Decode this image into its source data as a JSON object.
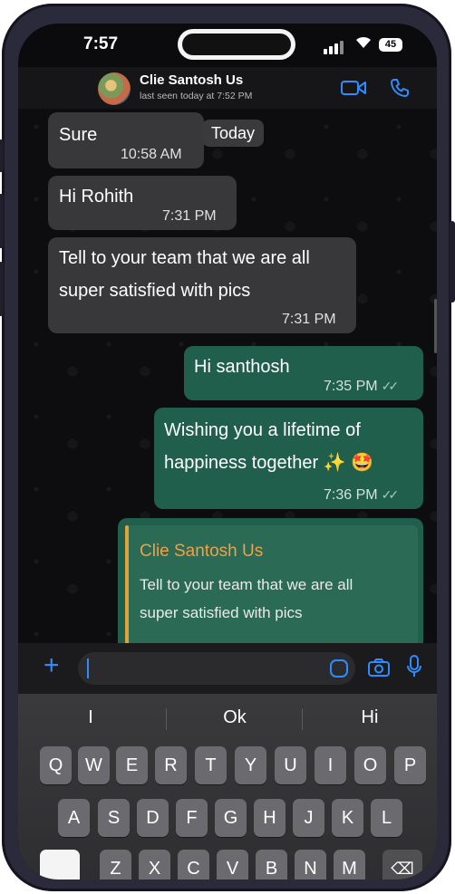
{
  "status_bar": {
    "time": "7:57",
    "battery": "45"
  },
  "header": {
    "contact_name": "Clie Santosh Us",
    "last_seen": "last seen today at 7:52 PM"
  },
  "chat": {
    "date_chip": "Today",
    "messages": [
      {
        "direction": "incoming",
        "lines": [
          "Sure"
        ],
        "time": "10:58 AM"
      },
      {
        "direction": "incoming",
        "lines": [
          "Hi Rohith"
        ],
        "time": "7:31 PM"
      },
      {
        "direction": "incoming",
        "lines": [
          "Tell to your team that we are all",
          "super satisfied with pics"
        ],
        "time": "7:31 PM"
      },
      {
        "direction": "outgoing",
        "lines": [
          "Hi santhosh"
        ],
        "time": "7:35 PM",
        "read": true
      },
      {
        "direction": "outgoing",
        "lines": [
          "Wishing you a lifetime of",
          "happiness together ✨ 🤩"
        ],
        "time": "7:36 PM",
        "read": true
      },
      {
        "direction": "outgoing",
        "reply": {
          "author": "Clie Santosh Us",
          "lines": [
            "Tell to your team that we are all",
            "super satisfied with pics"
          ]
        }
      }
    ]
  },
  "input": {
    "placeholder": ""
  },
  "keyboard": {
    "suggestions": [
      "I",
      "Ok",
      "Hi"
    ],
    "rows": [
      [
        "Q",
        "W",
        "E",
        "R",
        "T",
        "Y",
        "U",
        "I",
        "O",
        "P"
      ],
      [
        "A",
        "S",
        "D",
        "F",
        "G",
        "H",
        "J",
        "K",
        "L"
      ],
      [
        "Z",
        "X",
        "C",
        "V",
        "B",
        "N",
        "M"
      ]
    ]
  },
  "colors": {
    "accent": "#2e8cff",
    "outgoing_bubble": "#1f5f4c",
    "incoming_bubble": "#38383b",
    "reply_author": "#f0a045"
  }
}
